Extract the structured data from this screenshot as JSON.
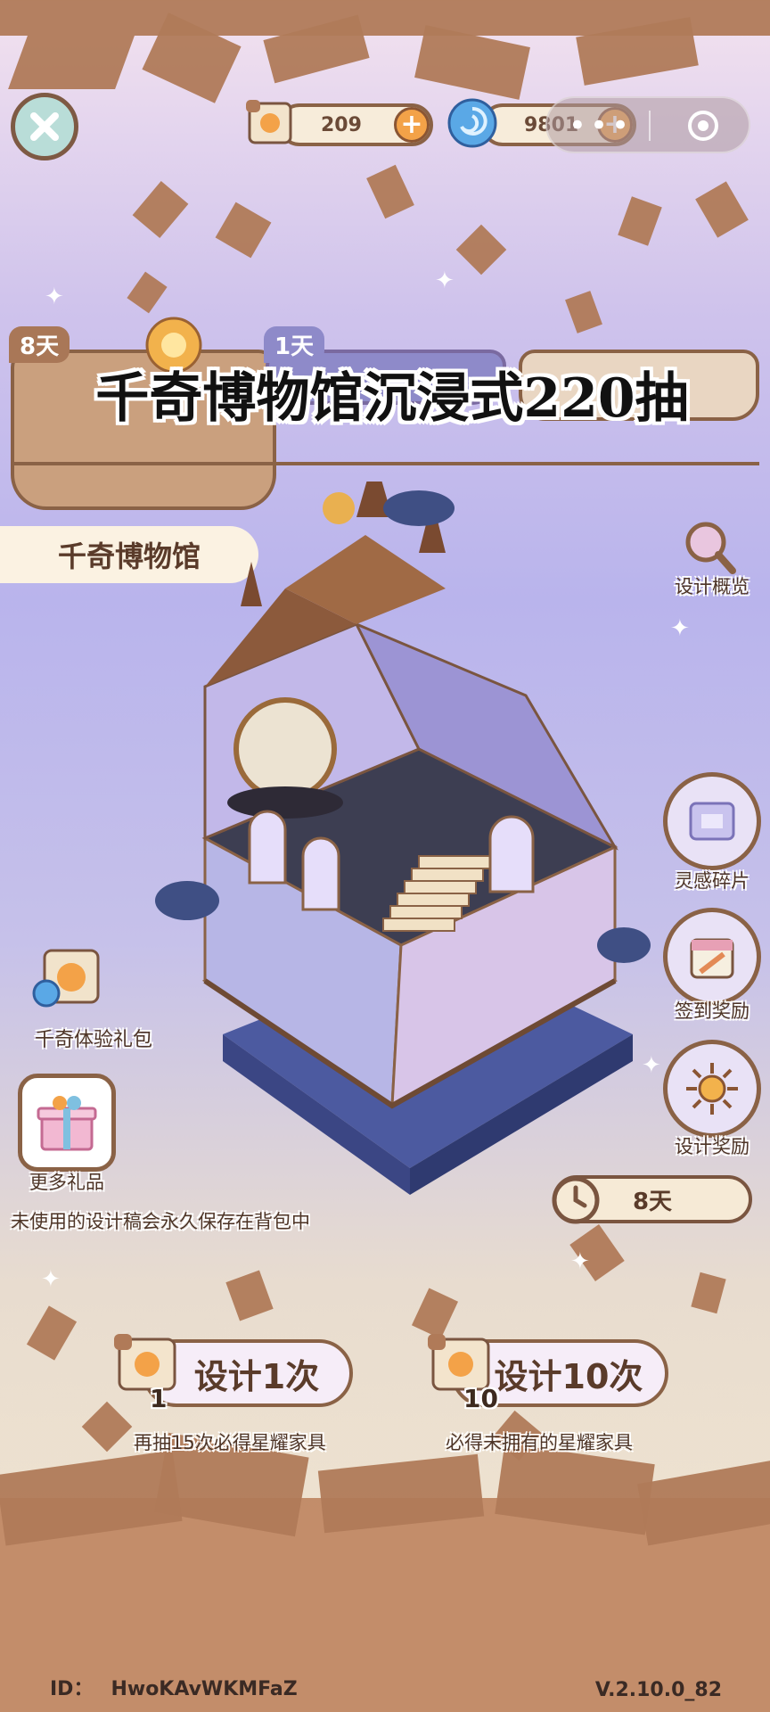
{
  "header": {
    "scroll_count": "209",
    "currency_count": "9801",
    "plus_label": "+"
  },
  "banner": {
    "title": "千奇博物馆沉浸式220抽",
    "tab1_days": "8天",
    "tab2_days": "1天"
  },
  "museum": {
    "name": "千奇博物馆"
  },
  "right_menu": {
    "overview": "设计概览",
    "inspiration": "灵感碎片",
    "checkin": "签到奖励",
    "design_reward": "设计奖励"
  },
  "left_menu": {
    "trial_pack": "千奇体验礼包",
    "more_gifts": "更多礼品"
  },
  "timer": {
    "days": "8天"
  },
  "notice": "未使用的设计稿会永久保存在背包中",
  "draw": {
    "single_label": "设计1次",
    "single_cost": "1",
    "single_note": "再抽15次必得星耀家具",
    "ten_label": "设计10次",
    "ten_cost": "10",
    "ten_note": "必得未拥有的星耀家具"
  },
  "footer": {
    "id_label": "ID：",
    "id_value": "HwoKAvWKMFaZ",
    "version": "V.2.10.0_82"
  },
  "colors": {
    "accent_brown": "#8a6246",
    "plus_orange": "#f3a248",
    "paper_brown": "#b07a58"
  }
}
